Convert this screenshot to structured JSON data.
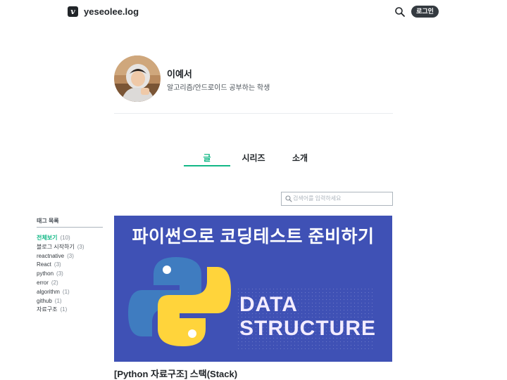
{
  "header": {
    "logo_letter": "v",
    "blog_name": "yeseolee.log",
    "login_label": "로그인",
    "icons": {
      "search": "search-icon"
    }
  },
  "profile": {
    "name": "이예서",
    "description": "알고리즘/안드로이드 공부하는 학생"
  },
  "tabs": [
    {
      "label": "글",
      "active": true
    },
    {
      "label": "시리즈",
      "active": false
    },
    {
      "label": "소개",
      "active": false
    }
  ],
  "search": {
    "placeholder": "검색어를 입력하세요",
    "value": ""
  },
  "tags": {
    "title": "태그 목록",
    "items": [
      {
        "name": "전체보기",
        "count": "(10)"
      },
      {
        "name": "블로그 시작하기",
        "count": "(3)"
      },
      {
        "name": "reactnative",
        "count": "(3)"
      },
      {
        "name": "React",
        "count": "(3)"
      },
      {
        "name": "python",
        "count": "(3)"
      },
      {
        "name": "error",
        "count": "(2)"
      },
      {
        "name": "algorithm",
        "count": "(1)"
      },
      {
        "name": "github",
        "count": "(1)"
      },
      {
        "name": "자료구조",
        "count": "(1)"
      }
    ]
  },
  "post": {
    "thumbnail": {
      "title": "파이썬으로 코딩테스트 준비하기",
      "line1": "DATA",
      "line2": "STRUCTURE"
    },
    "title": "[Python 자료구조] 스택(Stack)"
  },
  "colors": {
    "accent": "#12b886",
    "thumbnail_bg": "#3f51b5",
    "python_blue": "#3f7cc0",
    "python_yellow": "#ffd43b"
  }
}
